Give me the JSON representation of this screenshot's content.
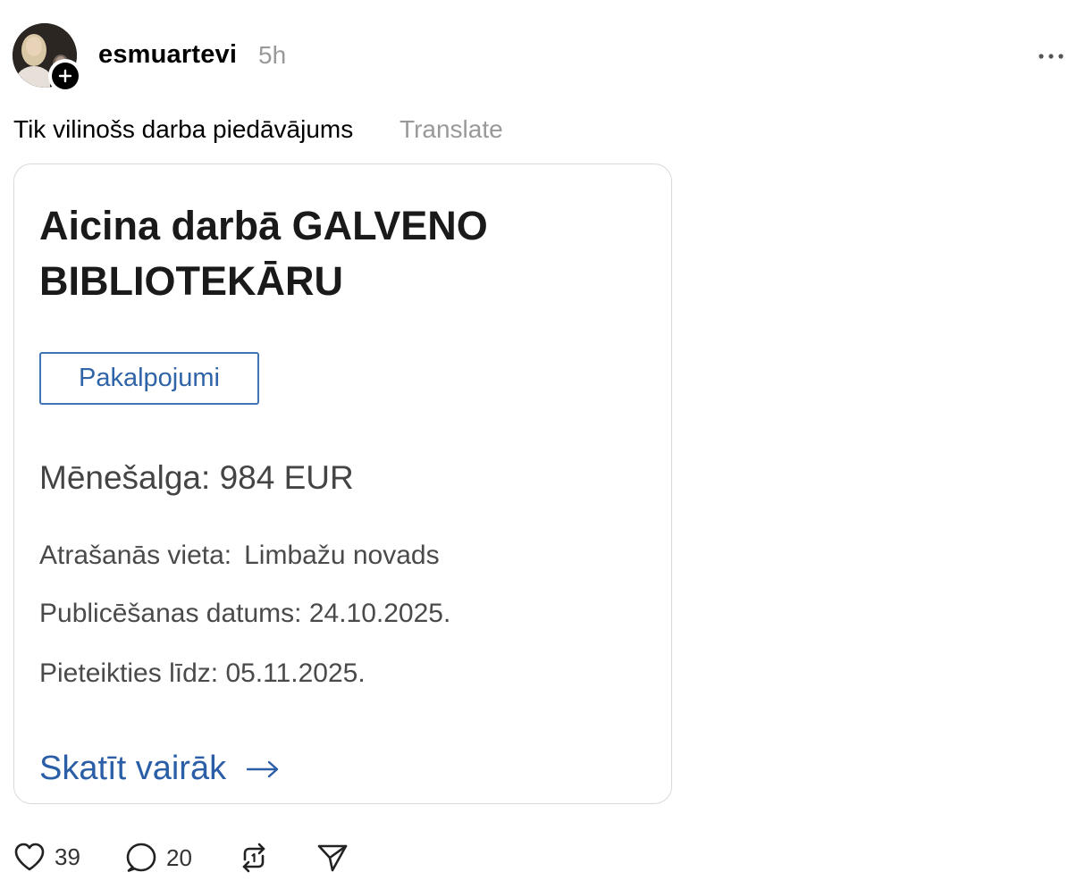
{
  "post": {
    "username": "esmuartevi",
    "time": "5h",
    "caption": "Tik vilinošs darba piedāvājums",
    "translate_label": "Translate"
  },
  "card": {
    "title": "Aicina darbā GALVENO BIBLIOTEKĀRU",
    "category": "Pakalpojumi",
    "salary": "Mēnešalga: 984 EUR",
    "location_label": "Atrašanās vieta:",
    "location_value": "Limbažu novads",
    "published_label": "Publicēšanas datums:",
    "published_value": "24.10.2025.",
    "deadline_label": "Pieteikties līdz:",
    "deadline_value": "05.11.2025.",
    "see_more_label": "Skatīt vairāk",
    "accent_color": "#2a5ea6"
  },
  "actions": {
    "likes": "39",
    "comments": "20"
  },
  "icons": {
    "follow": "plus-icon",
    "more": "more-horizontal-icon",
    "like": "heart-icon",
    "comment": "comment-icon",
    "repost": "repost-icon",
    "share": "send-icon",
    "see_more": "arrow-right-icon"
  }
}
